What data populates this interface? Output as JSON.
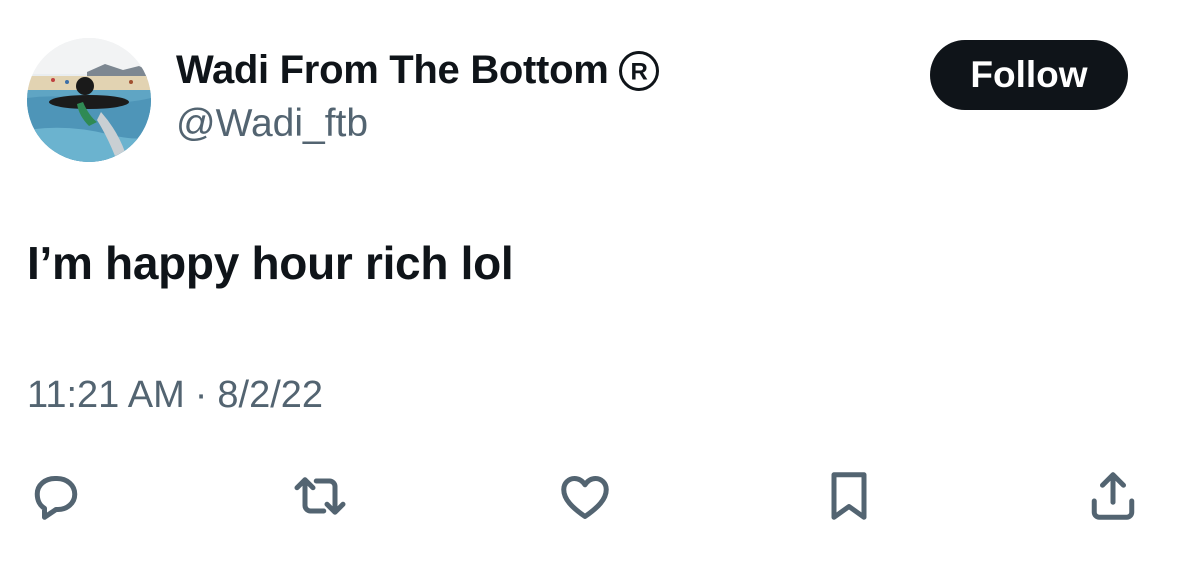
{
  "author": {
    "display_name": "Wadi From The Bottom",
    "badge": "registered-mark-icon",
    "handle": "@Wadi_ftb"
  },
  "follow_button": {
    "label": "Follow"
  },
  "tweet": {
    "text": "I’m happy hour rich lol",
    "time": "11:21 AM",
    "separator": "·",
    "date": "8/2/22"
  },
  "actions": [
    "reply-icon",
    "retweet-icon",
    "like-icon",
    "bookmark-icon",
    "share-icon"
  ],
  "colors": {
    "primary_text": "#0f1419",
    "secondary_text": "#536471",
    "button_bg": "#0f1419",
    "button_text": "#ffffff",
    "background": "#ffffff"
  }
}
